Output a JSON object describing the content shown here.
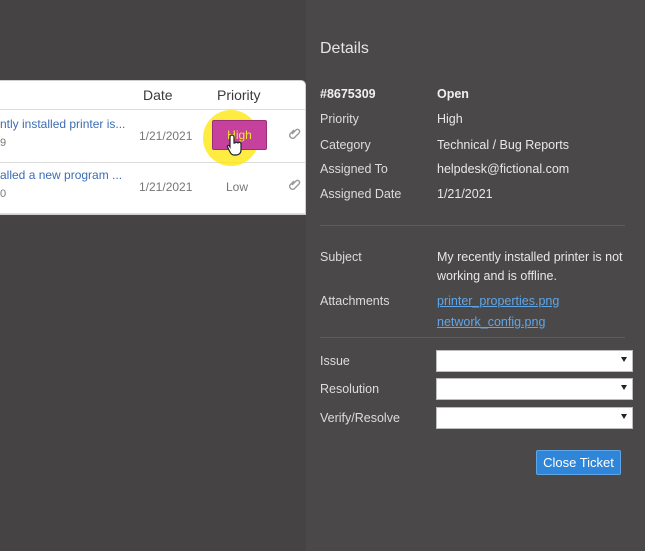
{
  "list": {
    "headers": {
      "date": "Date",
      "priority": "Priority"
    },
    "rows": [
      {
        "subject": "ntly installed printer is...",
        "id": "9",
        "date": "1/21/2021",
        "priority": "High"
      },
      {
        "subject": "alled a new program ...",
        "id": "0",
        "date": "1/21/2021",
        "priority": "Low"
      }
    ]
  },
  "details": {
    "title": "Details",
    "ticket_id": "#8675309",
    "status": "Open",
    "fields": {
      "priority_label": "Priority",
      "priority_value": "High",
      "category_label": "Category",
      "category_value": "Technical / Bug Reports",
      "assigned_to_label": "Assigned To",
      "assigned_to_value": "helpdesk@fictional.com",
      "assigned_date_label": "Assigned Date",
      "assigned_date_value": "1/21/2021"
    },
    "subject_label": "Subject",
    "subject_value": "My recently installed printer is not working and is offline.",
    "attachments_label": "Attachments",
    "attachments": [
      "printer_properties.png",
      "network_config.png"
    ],
    "issue_label": "Issue",
    "resolution_label": "Resolution",
    "verify_label": "Verify/Resolve",
    "issue_value": "",
    "resolution_value": "",
    "verify_value": "",
    "close_button": "Close Ticket"
  },
  "colors": {
    "highlight": "#ffe600",
    "high_badge": "#c6409e",
    "link": "#5fa6e8",
    "primary_button": "#2f85d8"
  }
}
